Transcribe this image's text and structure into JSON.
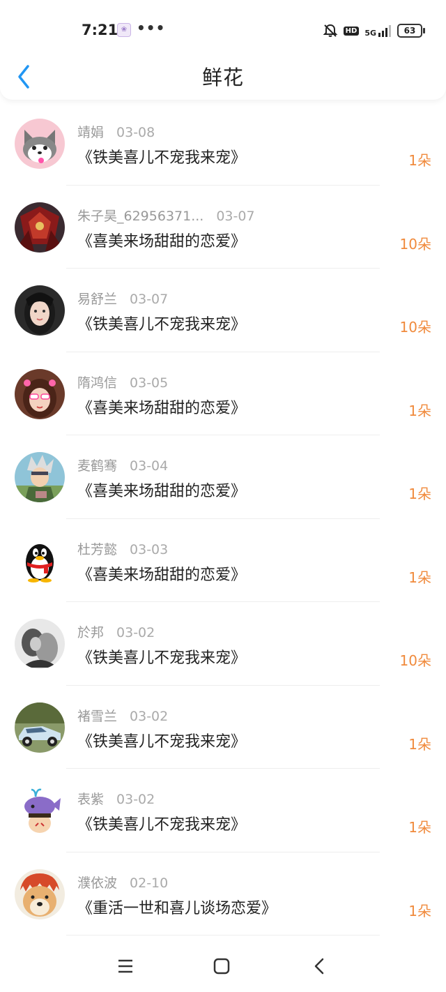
{
  "status_bar": {
    "time": "7:21",
    "app_icon": "paw-icon",
    "more": "•••",
    "hd": "HD",
    "network": "5G",
    "battery": "63"
  },
  "header": {
    "title": "鲜花",
    "back_icon": "chevron-left-icon"
  },
  "colors": {
    "accent": "#f08a3c",
    "back_arrow": "#2196f3",
    "name_text": "#999999",
    "title_text": "#222222"
  },
  "gifts": [
    {
      "name": "靖娟",
      "date": "03-08",
      "book": "《铁美喜儿不宠我来宠》",
      "count": "1朵",
      "avatar": "husky-cartoon-avatar"
    },
    {
      "name": "朱子昊_62956371...",
      "date": "03-07",
      "book": "《喜美来场甜甜的恋爱》",
      "count": "10朵",
      "avatar": "red-armor-avatar"
    },
    {
      "name": "易舒兰",
      "date": "03-07",
      "book": "《铁美喜儿不宠我来宠》",
      "count": "10朵",
      "avatar": "girl-portrait-avatar"
    },
    {
      "name": "隋鸿信",
      "date": "03-05",
      "book": "《喜美来场甜甜的恋爱》",
      "count": "1朵",
      "avatar": "girl-sunglasses-avatar"
    },
    {
      "name": "麦鹤骞",
      "date": "03-04",
      "book": "《喜美来场甜甜的恋爱》",
      "count": "1朵",
      "avatar": "anime-character-avatar"
    },
    {
      "name": "杜芳懿",
      "date": "03-03",
      "book": "《喜美来场甜甜的恋爱》",
      "count": "1朵",
      "avatar": "qq-penguin-avatar"
    },
    {
      "name": "於邦",
      "date": "03-02",
      "book": "《铁美喜儿不宠我来宠》",
      "count": "10朵",
      "avatar": "bw-couple-avatar"
    },
    {
      "name": "褚雪兰",
      "date": "03-02",
      "book": "《铁美喜儿不宠我来宠》",
      "count": "1朵",
      "avatar": "vintage-car-avatar"
    },
    {
      "name": "表紫",
      "date": "03-02",
      "book": "《铁美喜儿不宠我来宠》",
      "count": "1朵",
      "avatar": "whale-cartoon-avatar"
    },
    {
      "name": "濮依波",
      "date": "02-10",
      "book": "《重活一世和喜儿谈场恋爱》",
      "count": "1朵",
      "avatar": "doge-avatar"
    }
  ],
  "nav_bar": {
    "menu_icon": "menu-icon",
    "home_icon": "home-square-icon",
    "back_icon": "back-triangle-icon"
  }
}
